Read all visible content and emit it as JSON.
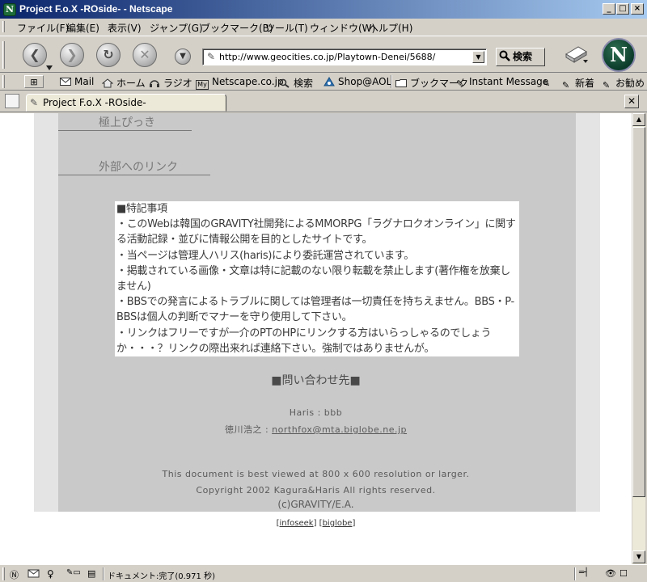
{
  "window": {
    "title": "Project F.o.X -ROside- - Netscape",
    "app_icon": "N"
  },
  "menu": [
    "ファイル(F)",
    "編集(E)",
    "表示(V)",
    "ジャンプ(G)",
    "ブックマーク(B)",
    "ツール(T)",
    "ウィンドウ(W)",
    "ヘルプ(H)"
  ],
  "nav": {
    "url": "http://www.geocities.co.jp/Playtown-Denei/5688/",
    "search_label": "検索",
    "logo": "N"
  },
  "personal_toolbar": {
    "items": [
      "Mail",
      "ホーム",
      "ラジオ",
      "Netscape.co.jp",
      "検索",
      "Shop@AOL",
      "ブックマーク",
      "Instant Message",
      "新着",
      "お勧め"
    ]
  },
  "tab": {
    "title": "Project F.o.X -ROside-"
  },
  "page": {
    "links": [
      "極上ぴっき",
      "外部へのリンク"
    ],
    "notice": [
      "■特記事項",
      "・このWebは韓国のGRAVITY社開発によるMMORPG「ラグナロクオンライン」に関する活動記録・並びに情報公開を目的としたサイトです。",
      "・当ページは管理人ハリス(haris)により委託運営されています。",
      "・掲載されている画像・文章は特に記載のない限り転載を禁止します(著作権を放棄しません)",
      "・BBSでの発言によるトラブルに関しては管理者は一切責任を持ちえません。BBS・P-BBSは個人の判断でマナーを守り使用して下さい。",
      "・リンクはフリーですが一介のPTのHPにリンクする方はいらっしゃるのでしょうか・・・？リンクの際出来れば連絡下さい。強制ではありませんが。"
    ],
    "contact_heading": "■問い合わせ先■",
    "contact_haris": "Haris : bbb",
    "contact_tokugawa_label": "徳川浩之 : ",
    "contact_tokugawa_email": "northfox@mta.biglobe.ne.jp",
    "viewing_note": "This document is best viewed at 800 x 600 resolution or larger.",
    "copyright": "Copyright 2002 Kagura&Haris All rights reserved.",
    "gravity_credit": "(c)GRAVITY/E.A.",
    "footer_links": [
      "infoseek",
      "biglobe"
    ],
    "footer_open": "[",
    "footer_mid": "] [",
    "footer_close": "]"
  },
  "status": {
    "text": "ドキュメント:完了(0.971 秒)"
  },
  "colors": {
    "titlebar_start": "#0a246a",
    "titlebar_end": "#a6caf0",
    "chrome": "#d4d0c8",
    "page_outer": "#e4e4e4",
    "page_inner": "#c9c9c9",
    "notice_bg": "#ffffff"
  },
  "icons": [
    "netscape-icon",
    "back-icon",
    "forward-icon",
    "reload-icon",
    "stop-icon",
    "history-dropdown-icon",
    "page-icon",
    "search-icon",
    "send-page-icon",
    "netscape-throbber-icon",
    "mail-icon",
    "home-icon",
    "radio-icon",
    "bookmark-folder-icon",
    "aol-icon",
    "instant-message-icon",
    "link-icon",
    "close-tab-icon"
  ]
}
